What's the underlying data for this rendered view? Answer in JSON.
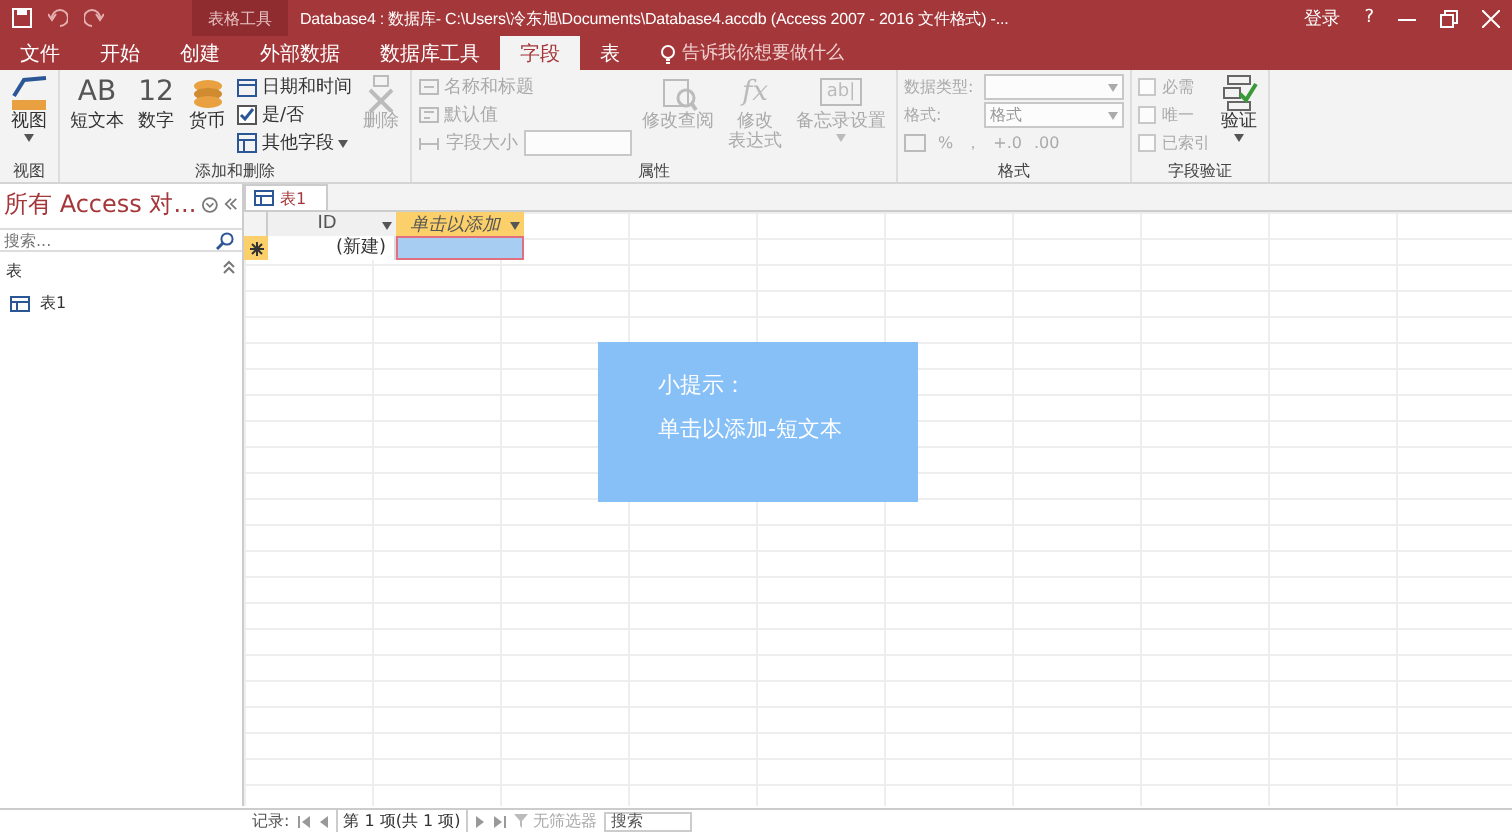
{
  "title_bar": {
    "contextual_tab": "表格工具",
    "title": "Database4 : 数据库- C:\\Users\\冷东旭\\Documents\\Database4.accdb (Access 2007 - 2016 文件格式) -...",
    "sign_in": "登录",
    "help": "?"
  },
  "ribbon_tabs": [
    {
      "label": "文件",
      "selected": false
    },
    {
      "label": "开始",
      "selected": false
    },
    {
      "label": "创建",
      "selected": false
    },
    {
      "label": "外部数据",
      "selected": false
    },
    {
      "label": "数据库工具",
      "selected": false
    },
    {
      "label": "字段",
      "selected": true
    },
    {
      "label": "表",
      "selected": false
    }
  ],
  "tell_me": "告诉我你想要做什么",
  "ribbon_groups": [
    {
      "label": "视图",
      "items": [
        {
          "kind": "large",
          "label": "视图",
          "dropdown": true,
          "disabled": false
        }
      ]
    },
    {
      "label": "添加和删除",
      "items": [
        {
          "kind": "large",
          "glyph": "AB",
          "label": "短文本",
          "dropdown": false,
          "disabled": false
        },
        {
          "kind": "large",
          "glyph": "12",
          "label": "数字",
          "dropdown": false,
          "disabled": false
        },
        {
          "kind": "large",
          "label": "货币",
          "dropdown": false,
          "disabled": false
        },
        {
          "kind": "stack",
          "items": [
            {
              "kind": "small",
              "label": "日期和时间",
              "dropdown": false,
              "disabled": false
            },
            {
              "kind": "small",
              "label": "是/否",
              "dropdown": false,
              "disabled": false
            },
            {
              "kind": "small",
              "label": "其他字段",
              "dropdown": true,
              "disabled": false
            }
          ]
        },
        {
          "kind": "large",
          "label": "删除",
          "dropdown": false,
          "disabled": true
        }
      ]
    },
    {
      "label": "属性",
      "items": [
        {
          "kind": "stack",
          "items": [
            {
              "kind": "small",
              "label": "名称和标题",
              "dropdown": false,
              "disabled": true
            },
            {
              "kind": "small",
              "label": "默认值",
              "dropdown": false,
              "disabled": true
            },
            {
              "kind": "field",
              "label": "字段大小",
              "disabled": true
            }
          ]
        },
        {
          "kind": "large",
          "label": "修改查阅",
          "dropdown": false,
          "disabled": true
        },
        {
          "kind": "large",
          "glyph": "fx",
          "label": "修改",
          "label_2": "表达式",
          "dropdown": false,
          "disabled": true
        },
        {
          "kind": "large",
          "glyph": "ab|",
          "label": "备忘录设置",
          "dropdown": true,
          "disabled": true
        }
      ]
    },
    {
      "label": "格式",
      "items": [
        {
          "kind": "stack",
          "items": [
            {
              "kind": "combo",
              "label": "数据类型:",
              "disabled": true
            },
            {
              "kind": "combo",
              "label": "格式:",
              "value": "格式",
              "disabled": true
            },
            {
              "kind": "numfmt",
              "glyphs": [
                "%",
                "，",
                "+.0",
                ".00"
              ],
              "disabled": true
            }
          ]
        }
      ]
    },
    {
      "label": "字段验证",
      "items": [
        {
          "kind": "stack",
          "items": [
            {
              "kind": "check",
              "label": "必需",
              "checked": false,
              "disabled": true
            },
            {
              "kind": "check",
              "label": "唯一",
              "checked": false,
              "disabled": true
            },
            {
              "kind": "check",
              "label": "已索引",
              "checked": false,
              "disabled": true
            }
          ]
        },
        {
          "kind": "large",
          "label": "验证",
          "dropdown": true,
          "disabled": false
        }
      ]
    }
  ],
  "nav_pane": {
    "title": "所有 Access 对...",
    "search": {
      "placeholder": "搜索..."
    },
    "section": "表",
    "items": [
      {
        "label": "表1",
        "selected": false
      }
    ]
  },
  "doc_tabs": [
    {
      "label": "表1",
      "selected": true
    }
  ],
  "table": {
    "columns": [
      {
        "label": "ID",
        "selected": false
      },
      {
        "label": "单击以添加",
        "selected": true
      }
    ],
    "new_row": {
      "cells": [
        {
          "text": "(新建)",
          "selected": false
        },
        {
          "text": "",
          "selected": true
        }
      ]
    }
  },
  "tooltip": {
    "title": "小提示：",
    "text": "单击以添加-短文本"
  },
  "status_bar": {
    "label": "记录:",
    "position": "第 1 项(共 1 项)",
    "filter": "无筛选器",
    "search": "搜索"
  }
}
